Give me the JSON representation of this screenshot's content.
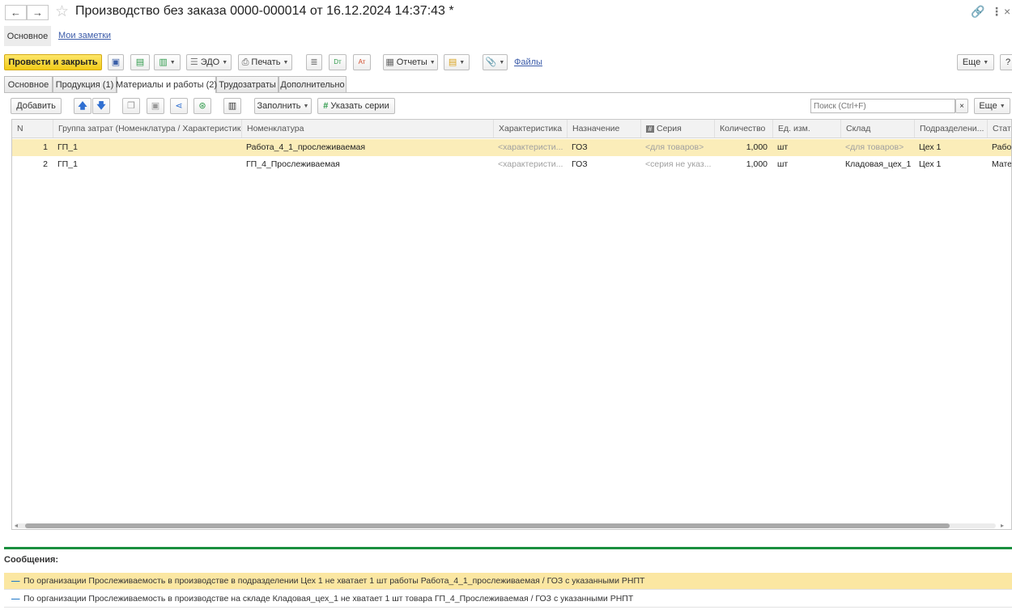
{
  "window": {
    "title": "Производство без заказа 0000-000014 от 16.12.2024 14:37:43 *"
  },
  "nav": {
    "main": "Основное",
    "notes": "Мои заметки"
  },
  "toolbar": {
    "post_close": "Провести и закрыть",
    "edo": "ЭДО",
    "print": "Печать",
    "reports": "Отчеты",
    "files": "Файлы",
    "more": "Еще",
    "help": "?"
  },
  "tabs": [
    {
      "label": "Основное"
    },
    {
      "label": "Продукция (1)"
    },
    {
      "label": "Материалы и работы (2)"
    },
    {
      "label": "Трудозатраты"
    },
    {
      "label": "Дополнительно"
    }
  ],
  "subtoolbar": {
    "add": "Добавить",
    "fill": "Заполнить",
    "series": "Указать серии",
    "search_placeholder": "Поиск (Ctrl+F)",
    "more": "Еще"
  },
  "table": {
    "columns": [
      "N",
      "Группа затрат (Номенклатура / Характеристика)",
      "Номенклатура",
      "Характеристика",
      "Назначение",
      "Серия",
      "Количество",
      "Ед. изм.",
      "Склад",
      "Подразделени...",
      "Стать"
    ],
    "rows": [
      {
        "n": "1",
        "group": "ГП_1",
        "item": "Работа_4_1_прослеживаемая",
        "char": "<характеристи...",
        "purpose": "ГОЗ",
        "series": "<для товаров>",
        "qty": "1,000",
        "unit": "шт",
        "store": "<для товаров>",
        "dept": "Цех 1",
        "article": "Рабо"
      },
      {
        "n": "2",
        "group": "ГП_1",
        "item": "ГП_4_Прослеживаемая",
        "char": "<характеристи...",
        "purpose": "ГОЗ",
        "series": "<серия не указ...",
        "qty": "1,000",
        "unit": "шт",
        "store": "Кладовая_цех_1",
        "dept": "Цех 1",
        "article": "Мате"
      }
    ]
  },
  "messages": {
    "title": "Сообщения:",
    "items": [
      "По организации Прослеживаемость в производстве в подразделении Цех 1 не хватает 1 шт работы Работа_4_1_прослеживаемая / ГОЗ с указанными РНПТ",
      "По организации Прослеживаемость в производстве на складе Кладовая_цех_1 не хватает 1 шт товара ГП_4_Прослеживаемая / ГОЗ с указанными РНПТ"
    ]
  }
}
